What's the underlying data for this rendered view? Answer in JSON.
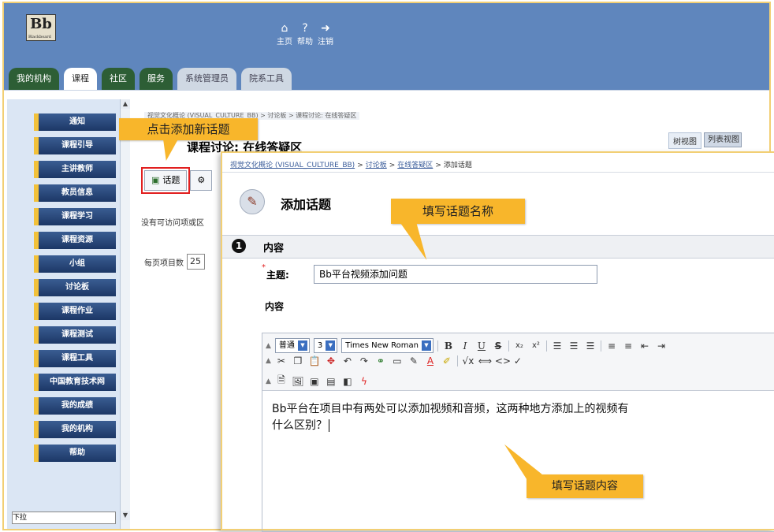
{
  "app": {
    "logo_text": "Bb",
    "logo_sub": "Blackboard"
  },
  "topnav": [
    {
      "label": "主页",
      "icon": "home-icon",
      "glyph": "⌂"
    },
    {
      "label": "帮助",
      "icon": "help-icon",
      "glyph": "?"
    },
    {
      "label": "注销",
      "icon": "logout-icon",
      "glyph": "➜"
    }
  ],
  "tabs": [
    "我的机构",
    "课程",
    "社区",
    "服务",
    "系统管理员",
    "院系工具"
  ],
  "sidebar": {
    "items": [
      "通知",
      "课程引导",
      "主讲教师",
      "教员信息",
      "课程学习",
      "课程资源",
      "小组",
      "讨论板",
      "课程作业",
      "课程测试",
      "课程工具",
      "中国教育技术网",
      "我的成绩",
      "我的机构",
      "帮助"
    ],
    "bottom_select": "下拉"
  },
  "back_page": {
    "breadcrumb": "视觉文化概论 (VISUAL_CULTURE_BB) > 讨论板 > 课程讨论: 在线答疑区",
    "title": "课程讨论:  在线答疑区",
    "view_tabs": [
      "树视图",
      "列表视图"
    ],
    "toolbar": {
      "new_thread": "话题"
    },
    "empty_message": "没有可访问项或区",
    "per_page_label": "每页项目数",
    "per_page_value": "25"
  },
  "overlay": {
    "breadcrumb": [
      {
        "text": "视觉文化概论 (VISUAL_CULTURE_BB)",
        "link": true
      },
      {
        "text": "讨论板",
        "link": true
      },
      {
        "text": "在线答疑区",
        "link": true
      },
      {
        "text": "添加话题",
        "link": false
      }
    ],
    "title": "添加话题",
    "section_number": "1",
    "section_title": "内容",
    "subject_label": "主题:",
    "subject_value": "Bb平台视频添加问题",
    "content_label": "内容",
    "editor": {
      "style_select": "普通",
      "size_select": "3",
      "font_select": "Times New Roman",
      "body_line1": "Bb平台在项目中有两处可以添加视频和音频，这两种地方添加上的视频有",
      "body_line2": "什么区别？"
    }
  },
  "callouts": {
    "add_thread": "点击添加新话题",
    "fill_title": "填写话题名称",
    "fill_content": "填写话题内容"
  }
}
